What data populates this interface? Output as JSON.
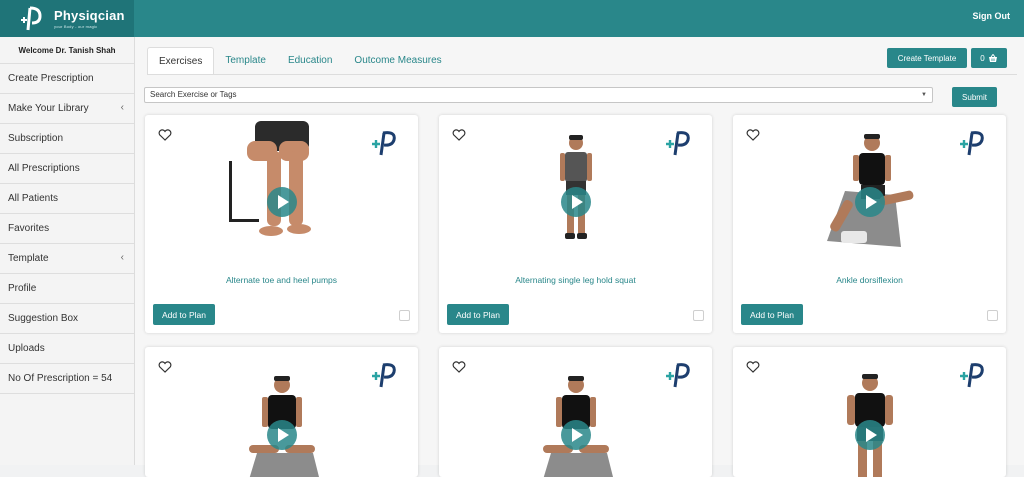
{
  "app": {
    "name": "Physiqcian",
    "tagline": "your Body - our magic",
    "sign_out": "Sign Out"
  },
  "sidebar": {
    "welcome": "Welcome Dr. Tanish Shah",
    "items": [
      {
        "label": "Create Prescription"
      },
      {
        "label": "Make Your Library",
        "chevron": "‹"
      },
      {
        "label": "Subscription"
      },
      {
        "label": "All Prescriptions"
      },
      {
        "label": "All Patients"
      },
      {
        "label": "Favorites"
      },
      {
        "label": "Template",
        "chevron": "‹"
      },
      {
        "label": "Profile"
      },
      {
        "label": "Suggestion Box"
      },
      {
        "label": "Uploads"
      },
      {
        "label": "No Of Prescription = 54"
      }
    ]
  },
  "tabs": [
    "Exercises",
    "Template",
    "Education",
    "Outcome Measures"
  ],
  "toolbar": {
    "create_template": "Create Template",
    "cart_count": "0"
  },
  "search": {
    "placeholder": "Search Exercise or Tags",
    "submit": "Submit"
  },
  "cards": [
    {
      "title": "Alternate toe and heel pumps",
      "add": "Add to Plan"
    },
    {
      "title": "Alternating single leg hold squat",
      "add": "Add to Plan"
    },
    {
      "title": "Ankle dorsiflexion",
      "add": "Add to Plan"
    },
    {
      "title": "",
      "add": ""
    },
    {
      "title": "",
      "add": ""
    },
    {
      "title": "",
      "add": ""
    }
  ],
  "colors": {
    "accent": "#29878a",
    "brand_dark": "#1d3e6e",
    "brand_teal": "#2aa3a3"
  }
}
